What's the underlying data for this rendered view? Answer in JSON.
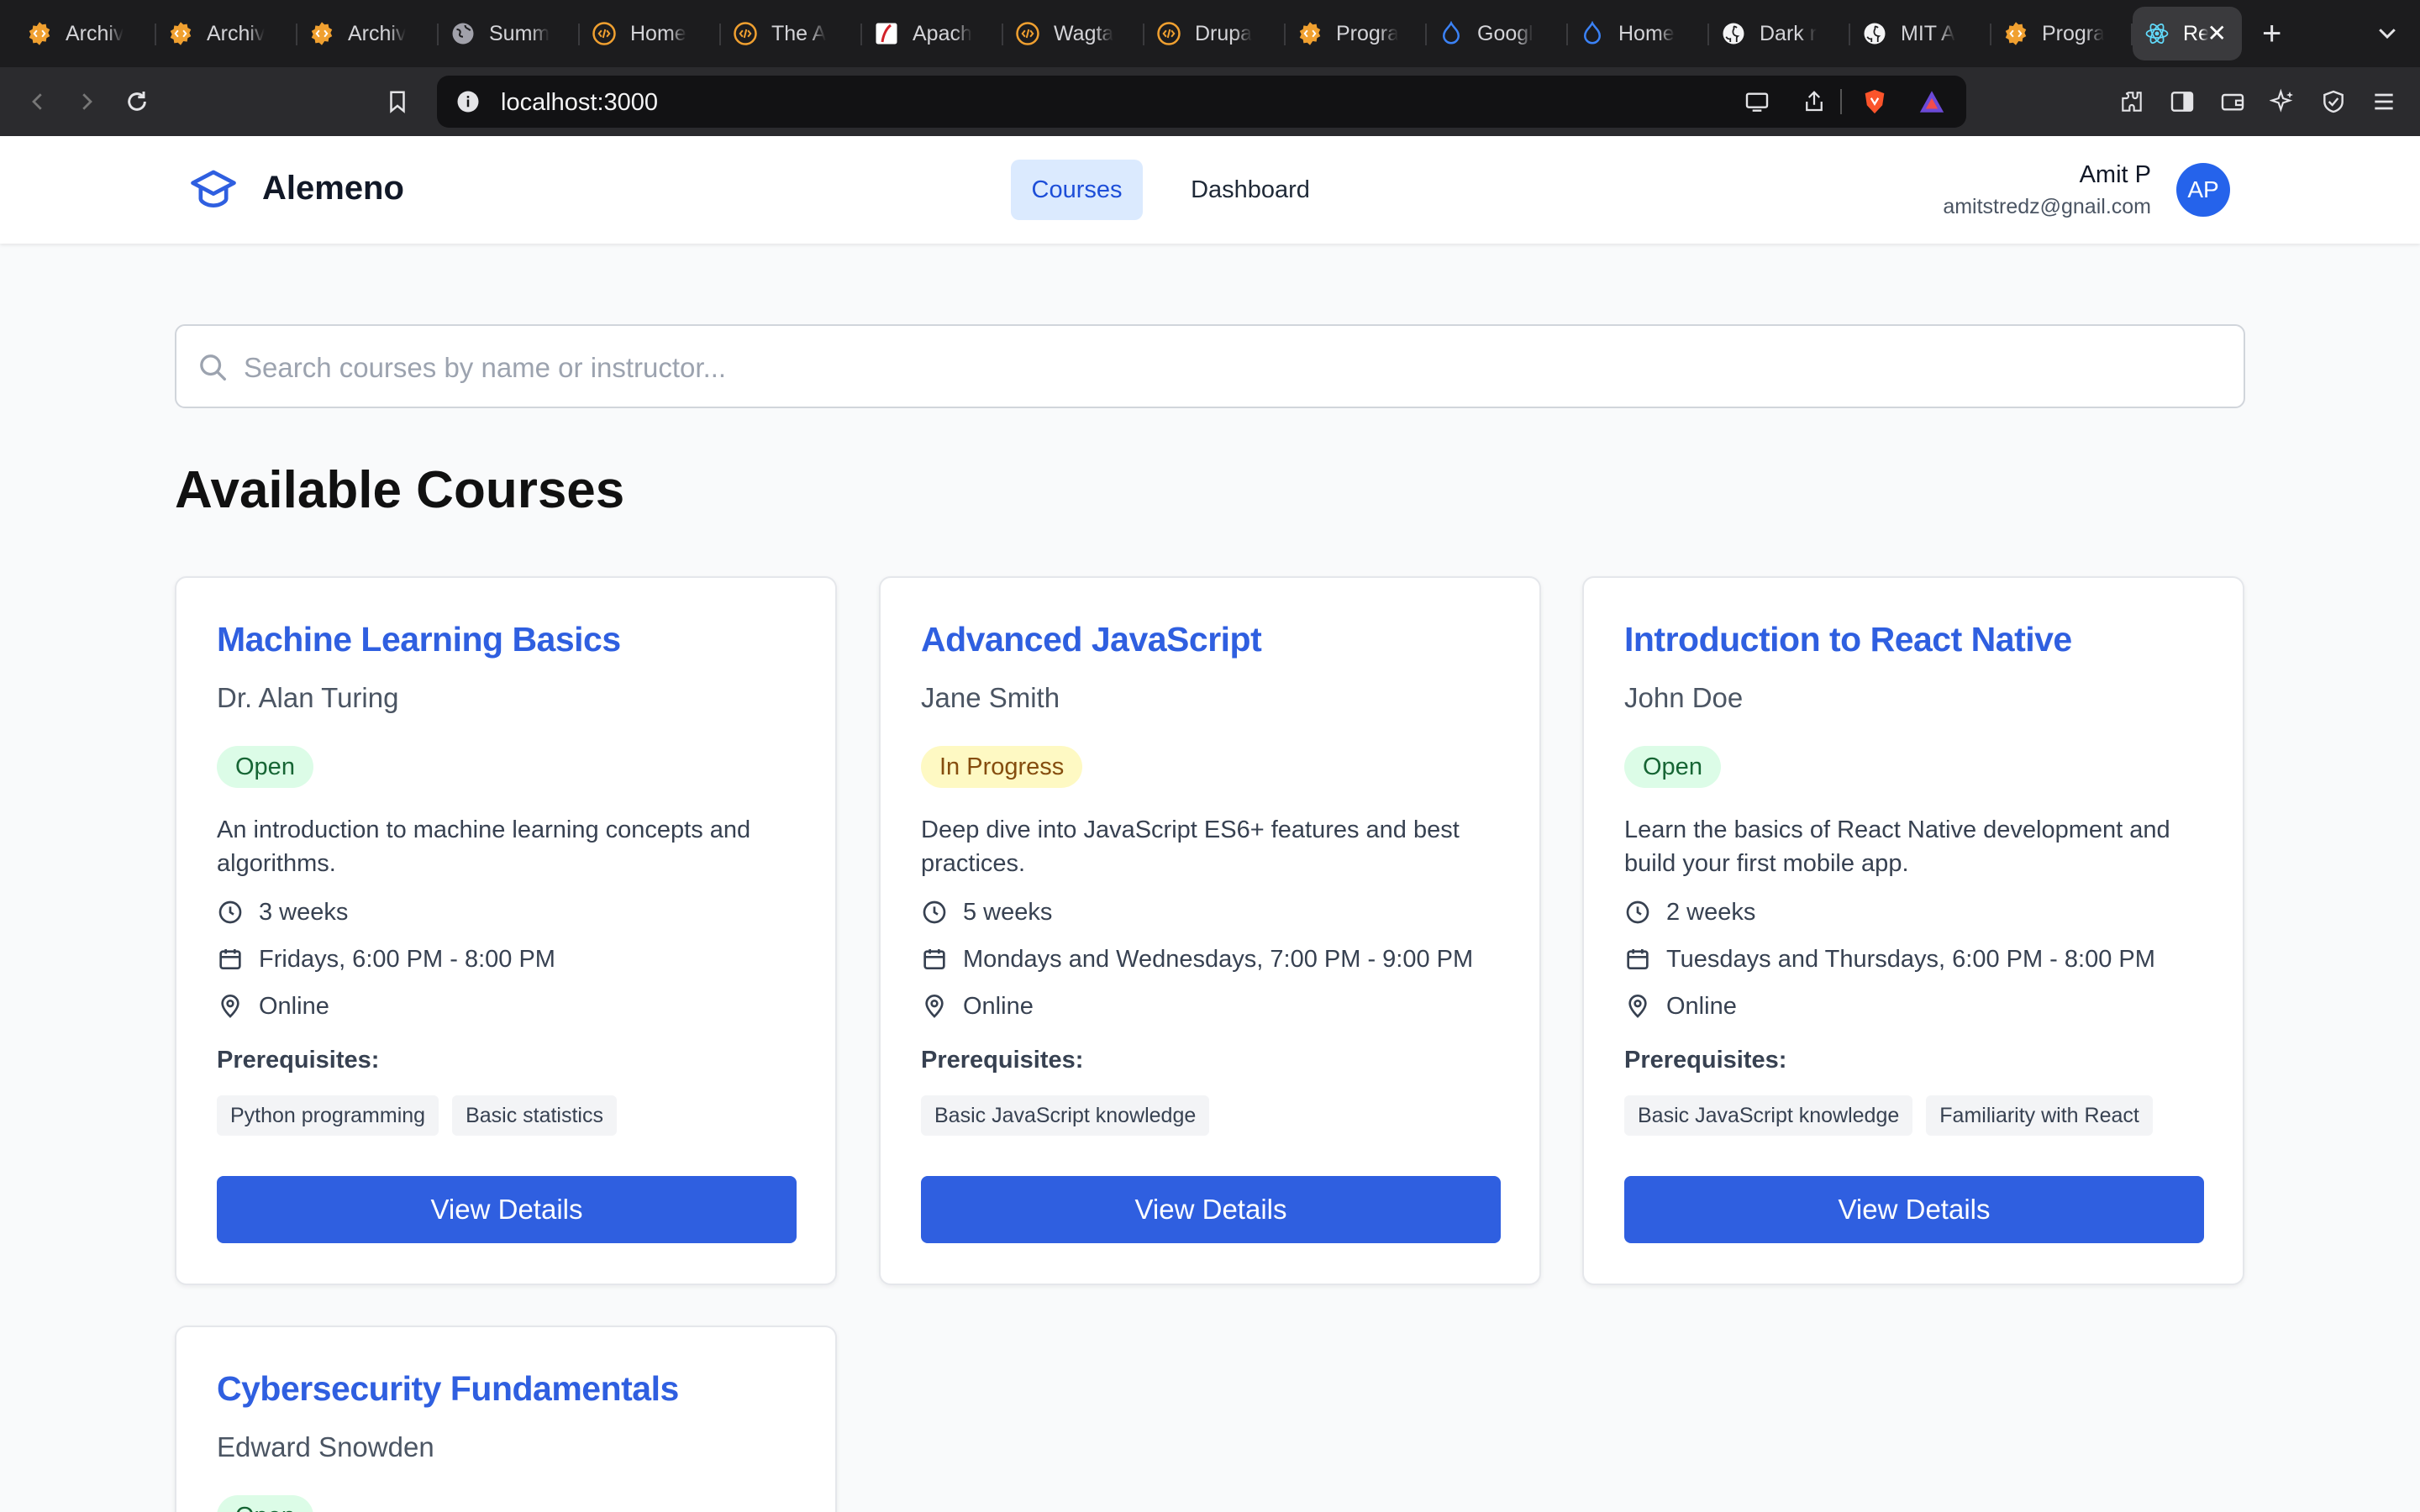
{
  "browser": {
    "tabs": [
      {
        "label": "Archiv",
        "icon": "code-badge-icon"
      },
      {
        "label": "Archiv",
        "icon": "code-badge-icon"
      },
      {
        "label": "Archiv",
        "icon": "code-badge-icon"
      },
      {
        "label": "Summ",
        "icon": "globe-icon"
      },
      {
        "label": "Home",
        "icon": "code-circle-icon"
      },
      {
        "label": "The A",
        "icon": "code-circle-icon"
      },
      {
        "label": "Apach",
        "icon": "apache-feather-icon"
      },
      {
        "label": "Wagta",
        "icon": "code-circle-icon"
      },
      {
        "label": "Drupa",
        "icon": "code-circle-icon"
      },
      {
        "label": "Progra",
        "icon": "code-badge-icon"
      },
      {
        "label": "Googl",
        "icon": "drupal-drop-icon"
      },
      {
        "label": "Home",
        "icon": "drupal-drop-icon"
      },
      {
        "label": "Dark r",
        "icon": "github-icon"
      },
      {
        "label": "MIT A",
        "icon": "github-icon"
      },
      {
        "label": "Progra",
        "icon": "code-badge-icon"
      },
      {
        "label": "Re",
        "icon": "react-icon",
        "active": true
      }
    ],
    "url": "localhost:3000",
    "notification_count": "1"
  },
  "header": {
    "brand": "Alemeno",
    "nav": [
      {
        "label": "Courses",
        "active": true
      },
      {
        "label": "Dashboard",
        "active": false
      }
    ],
    "user": {
      "name": "Amit P",
      "email": "amitstredz@gnail.com",
      "initials": "AP"
    }
  },
  "search": {
    "placeholder": "Search courses by name or instructor..."
  },
  "page_title": "Available Courses",
  "prereq_label": "Prerequisites:",
  "button_label": "View Details",
  "courses": [
    {
      "title": "Machine Learning Basics",
      "instructor": "Dr. Alan Turing",
      "status": "Open",
      "description": "An introduction to machine learning concepts and algorithms.",
      "duration": "3 weeks",
      "schedule": "Fridays, 6:00 PM - 8:00 PM",
      "location": "Online",
      "prerequisites": [
        "Python programming",
        "Basic statistics"
      ]
    },
    {
      "title": "Advanced JavaScript",
      "instructor": "Jane Smith",
      "status": "In Progress",
      "description": "Deep dive into JavaScript ES6+ features and best practices.",
      "duration": "5 weeks",
      "schedule": "Mondays and Wednesdays, 7:00 PM - 9:00 PM",
      "location": "Online",
      "prerequisites": [
        "Basic JavaScript knowledge"
      ]
    },
    {
      "title": "Introduction to React Native",
      "instructor": "John Doe",
      "status": "Open",
      "description": "Learn the basics of React Native development and build your first mobile app.",
      "duration": "2 weeks",
      "schedule": "Tuesdays and Thursdays, 6:00 PM - 8:00 PM",
      "location": "Online",
      "prerequisites": [
        "Basic JavaScript knowledge",
        "Familiarity with React"
      ]
    },
    {
      "title": "Cybersecurity Fundamentals",
      "instructor": "Edward Snowden",
      "status": "Open"
    }
  ],
  "colors": {
    "accent": "#2f5fe0",
    "nav_active_bg": "#dbeafe",
    "open_badge_bg": "#dcfce7",
    "progress_badge_bg": "#fef9c3"
  }
}
